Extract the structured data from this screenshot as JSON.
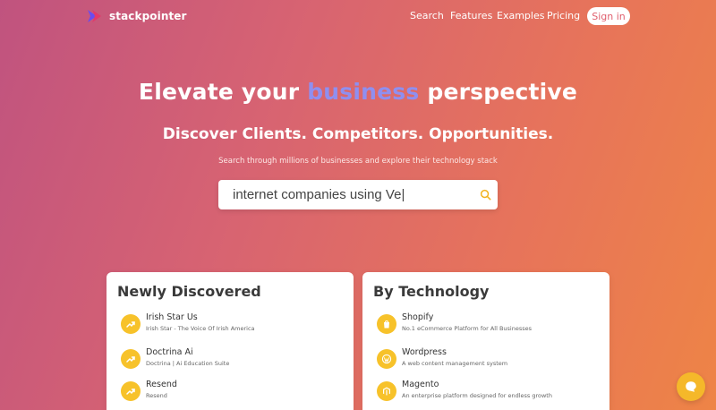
{
  "nav": {
    "brand": "stackpointer",
    "links": [
      "Search",
      "Features",
      "Examples",
      "Pricing"
    ],
    "signin_label": "Sign in"
  },
  "hero": {
    "title_pre": "Elevate your ",
    "title_accent": "business",
    "title_post": " perspective",
    "subtitle": "Discover Clients. Competitors. Opportunities.",
    "description": "Search through millions of businesses and explore their technology stack"
  },
  "search": {
    "value": "internet companies using Ve|",
    "icon": "search-icon"
  },
  "newly_discovered": {
    "title": "Newly Discovered",
    "items": [
      {
        "name": "Irish Star Us",
        "desc": "Irish Star - The Voice Of Irish America",
        "icon": "trend-icon"
      },
      {
        "name": "Doctrina Ai",
        "desc": "Doctrina | Ai Education Suite",
        "icon": "trend-icon"
      },
      {
        "name": "Resend",
        "desc": "Resend",
        "icon": "trend-icon"
      }
    ]
  },
  "by_technology": {
    "title": "By Technology",
    "items": [
      {
        "name": "Shopify",
        "desc": "No.1 eCommerce Platform for All Businesses",
        "icon": "shopify-icon"
      },
      {
        "name": "Wordpress",
        "desc": "A web content management system",
        "icon": "wordpress-icon"
      },
      {
        "name": "Magento",
        "desc": "An enterprise platform designed for endless growth",
        "icon": "magento-icon"
      }
    ]
  },
  "colors": {
    "accent": "#8f8ff0",
    "icon_bg": "#f7c22a",
    "chat_bg": "#f5b82a"
  }
}
